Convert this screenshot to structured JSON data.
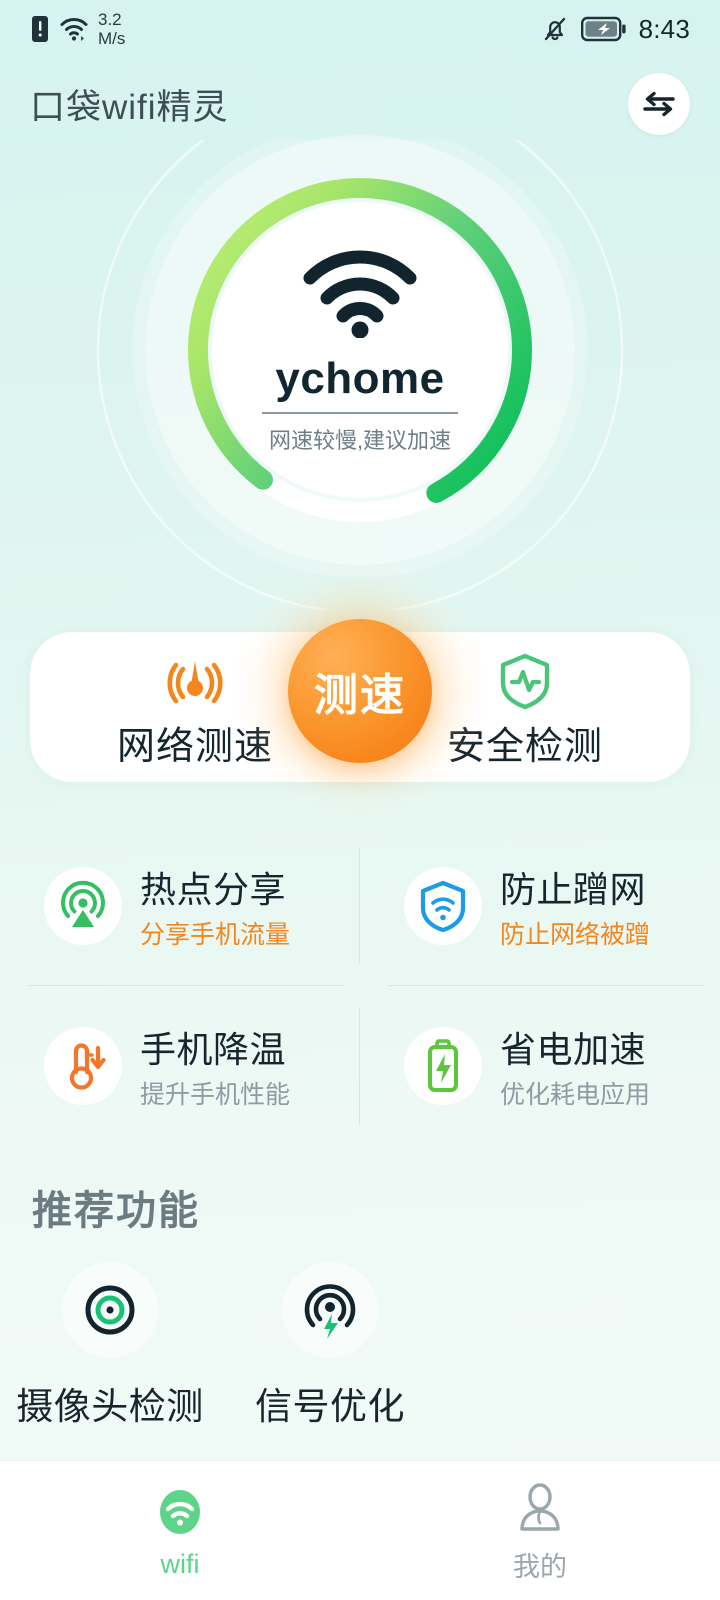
{
  "status_bar": {
    "net_speed_value": "3.2",
    "net_speed_unit": "M/s",
    "time": "8:43",
    "icons": [
      "sim-alert-icon",
      "wifi-signal-icon",
      "bell-muted-icon",
      "battery-charging-icon"
    ]
  },
  "header": {
    "title": "口袋wifi精灵",
    "switch_button_icon": "swap-arrows-icon"
  },
  "hero": {
    "ssid": "ychome",
    "status_text": "网速较慢,建议加速",
    "wifi_icon": "wifi-icon",
    "ring": {
      "progress_percent": 82,
      "gradient_from": "#b4ea6e",
      "gradient_to": "#12c05c",
      "track_color": "#ffffff"
    },
    "speed_test_button": {
      "label": "测速",
      "color": "#f8861c"
    }
  },
  "actions": [
    {
      "label": "网络测速",
      "icon": "speed-meter-icon",
      "color": "#f5861c"
    },
    {
      "label": "安全检测",
      "icon": "shield-pulse-icon",
      "color": "#4cc47a"
    }
  ],
  "features": [
    {
      "title": "热点分享",
      "subtitle": "分享手机流量",
      "subtitle_style": "accent",
      "icon": "broadcast-tower-icon",
      "color": "#34bf62"
    },
    {
      "title": "防止蹭网",
      "subtitle": "防止网络被蹭",
      "subtitle_style": "accent",
      "icon": "shield-wifi-icon",
      "color": "#1e9be8"
    },
    {
      "title": "手机降温",
      "subtitle": "提升手机性能",
      "subtitle_style": "muted",
      "icon": "thermometer-down-icon",
      "color": "#f5752a"
    },
    {
      "title": "省电加速",
      "subtitle": "优化耗电应用",
      "subtitle_style": "muted",
      "icon": "battery-bolt-icon",
      "color": "#5dc63c"
    }
  ],
  "recommend": {
    "title": "推荐功能",
    "items": [
      {
        "label": "摄像头检测",
        "icon": "camera-detect-icon"
      },
      {
        "label": "信号优化",
        "icon": "signal-boost-icon"
      }
    ]
  },
  "tabbar": [
    {
      "label": "wifi",
      "icon": "wifi-tab-icon",
      "active": true
    },
    {
      "label": "我的",
      "icon": "user-tab-icon",
      "active": false
    }
  ]
}
